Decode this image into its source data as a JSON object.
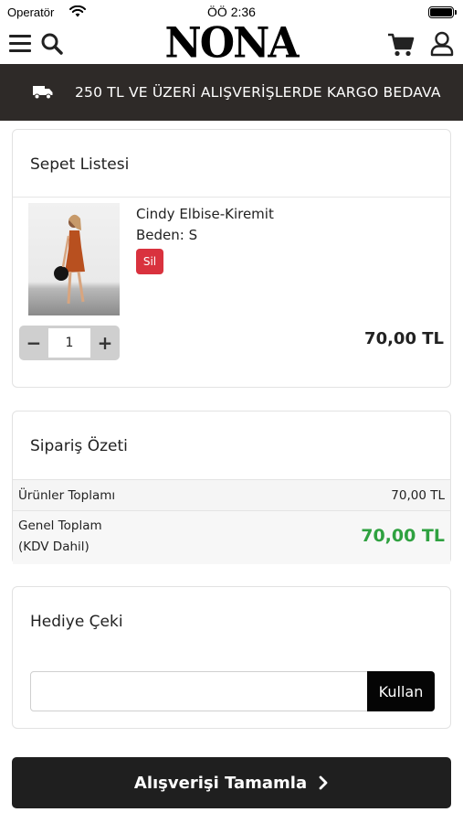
{
  "status_bar": {
    "carrier": "Operatör",
    "time": "ÖÖ 2:36"
  },
  "header": {
    "logo": "NONA",
    "icons": [
      "menu-icon",
      "search-icon",
      "cart-icon",
      "user-icon"
    ]
  },
  "banner": {
    "icon": "truck-icon",
    "text": "250 TL VE ÜZERİ ALIŞVERİŞLERDE KARGO BEDAVA"
  },
  "cart": {
    "title": "Sepet Listesi",
    "items": [
      {
        "name": "Cindy Elbise-Kiremit",
        "size": "Beden: S",
        "delete_label": "Sil",
        "minus": "−",
        "quantity": "1",
        "plus": "+",
        "price": "70,00 TL"
      }
    ]
  },
  "summary": {
    "title": "Sipariş Özeti",
    "subtotal_label": "Ürünler Toplamı",
    "subtotal_value": "70,00 TL",
    "total_label_line1": "Genel Toplam",
    "total_label_line2": "(KDV Dahil)",
    "total_value": "70,00 TL"
  },
  "gift": {
    "title": "Hediye Çeki",
    "input_value": "",
    "input_placeholder": "",
    "apply_label": "Kullan"
  },
  "checkout": {
    "label": "Alışverişi Tamamla"
  },
  "colors": {
    "banner_bg": "#2e2a28",
    "delete_red": "#d9323e",
    "total_green": "#2fa140",
    "button_dark": "#1f1f1f"
  }
}
